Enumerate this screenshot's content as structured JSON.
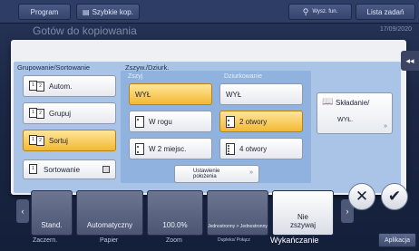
{
  "topbar": {
    "program": "Program",
    "quick_copy": "Szybkie kop.",
    "search": "Wysz. fun.",
    "job_list": "Lista zadań"
  },
  "behind": {
    "title": "Gotów do kopiowania",
    "date": "17/09/2020"
  },
  "grouping": {
    "title": "Grupowanie/Sortowanie",
    "auto": "Autom.",
    "group": "Grupuj",
    "sort": "Sortuj",
    "offset_sort": "Sortowanie"
  },
  "staple": {
    "title": "Zszyw./Dziurk.",
    "sub": "Zszyj",
    "off": "WYŁ",
    "corner": "W rogu",
    "two_pos": "W 2 miejsc.",
    "settings_line1": "Ustawienie",
    "settings_line2": "położenia"
  },
  "punch": {
    "sub": "Dziurkowanie",
    "off": "WYŁ",
    "two_holes": "2 otwory",
    "four_holes": "4 otwory"
  },
  "fold": {
    "title": "Składanie/",
    "value": "WYŁ."
  },
  "bottom": {
    "tiles": [
      {
        "label": "Stand.",
        "caption": "Zaczern."
      },
      {
        "label": "Automatyczny",
        "caption": "Papier"
      },
      {
        "label": "100.0%",
        "caption": "Zoom"
      },
      {
        "label": "Jednostronny > Jednostronny",
        "caption": "Dupleks/ Połącz"
      },
      {
        "label": "Nie zszywaj",
        "caption": "Wykańczanie"
      }
    ],
    "apps": "Aplikacja"
  },
  "buttons": {
    "cancel": "✕",
    "ok": "✔",
    "collapse": "◂◂"
  }
}
